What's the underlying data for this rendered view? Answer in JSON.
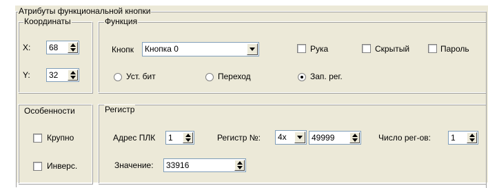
{
  "panel": {
    "title": "Атрибуты функциональной кнопки"
  },
  "coordinates": {
    "title": "Координаты",
    "x_label": "X:",
    "x_value": "68",
    "y_label": "Y:",
    "y_value": "32"
  },
  "function": {
    "title": "Функция",
    "button_label": "Кнопк",
    "button_value": "Кнопка 0",
    "checkbox_hand": "Рука",
    "checkbox_hidden": "Скрытый",
    "checkbox_password": "Пароль",
    "radio_set_bit": "Уст. бит",
    "radio_jump": "Переход",
    "radio_write_reg": "Зап. рег.",
    "selected_radio": "Зап. рег."
  },
  "features": {
    "title": "Особенности",
    "checkbox_large": "Крупно",
    "checkbox_invert": "Инверс."
  },
  "register": {
    "title": "Регистр",
    "plc_address_label": "Адрес ПЛК",
    "plc_address_value": "1",
    "reg_number_label": "Регистр №:",
    "reg_type_value": "4x",
    "reg_number_value": "49999",
    "reg_count_label": "Число рег-ов:",
    "reg_count_value": "1",
    "value_label": "Значение:",
    "value_value": "33916"
  }
}
